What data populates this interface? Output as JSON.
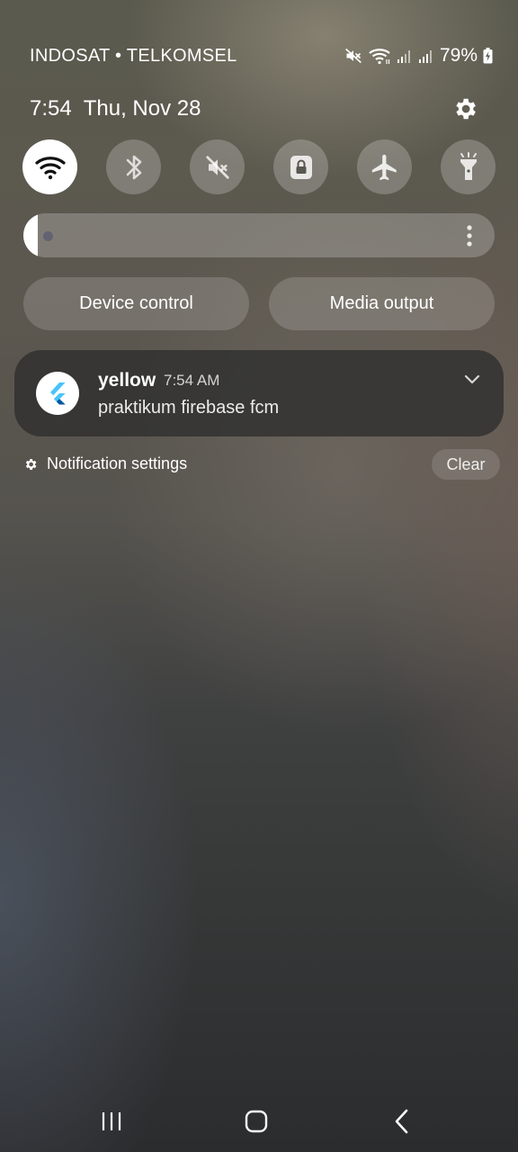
{
  "status_bar": {
    "carrier": "INDOSAT • TELKOMSEL",
    "battery_percent": "79%",
    "icons": [
      "mute-icon",
      "wifi-icon",
      "signal-icon-sim1",
      "signal-icon-sim2",
      "battery-charging-icon"
    ]
  },
  "header": {
    "time": "7:54",
    "date": "Thu, Nov 28",
    "settings_icon": "gear-icon"
  },
  "quick_toggles": [
    {
      "name": "wifi",
      "icon": "wifi-icon",
      "active": true
    },
    {
      "name": "bluetooth",
      "icon": "bluetooth-icon",
      "active": false
    },
    {
      "name": "sound",
      "icon": "mute-icon",
      "active": false
    },
    {
      "name": "rotation-lock",
      "icon": "rotation-lock-icon",
      "active": false
    },
    {
      "name": "airplane-mode",
      "icon": "airplane-icon",
      "active": false
    },
    {
      "name": "flashlight",
      "icon": "flashlight-icon",
      "active": false
    }
  ],
  "brightness": {
    "level": 0.03
  },
  "actions": {
    "device_control": "Device control",
    "media_output": "Media output"
  },
  "notification": {
    "app_name": "yellow",
    "time": "7:54 AM",
    "body": "praktikum firebase fcm",
    "app_icon": "flutter-logo-icon"
  },
  "footer": {
    "notification_settings": "Notification settings",
    "clear": "Clear"
  },
  "navigation": {
    "buttons": [
      "recent-apps-icon",
      "home-icon",
      "back-icon"
    ]
  },
  "colors": {
    "toggle_active": "#ffffff",
    "toggle_inactive": "rgba(255,255,255,0.22)",
    "flutter_blue_light": "#47c5fb",
    "flutter_blue_dark": "#00569e"
  }
}
